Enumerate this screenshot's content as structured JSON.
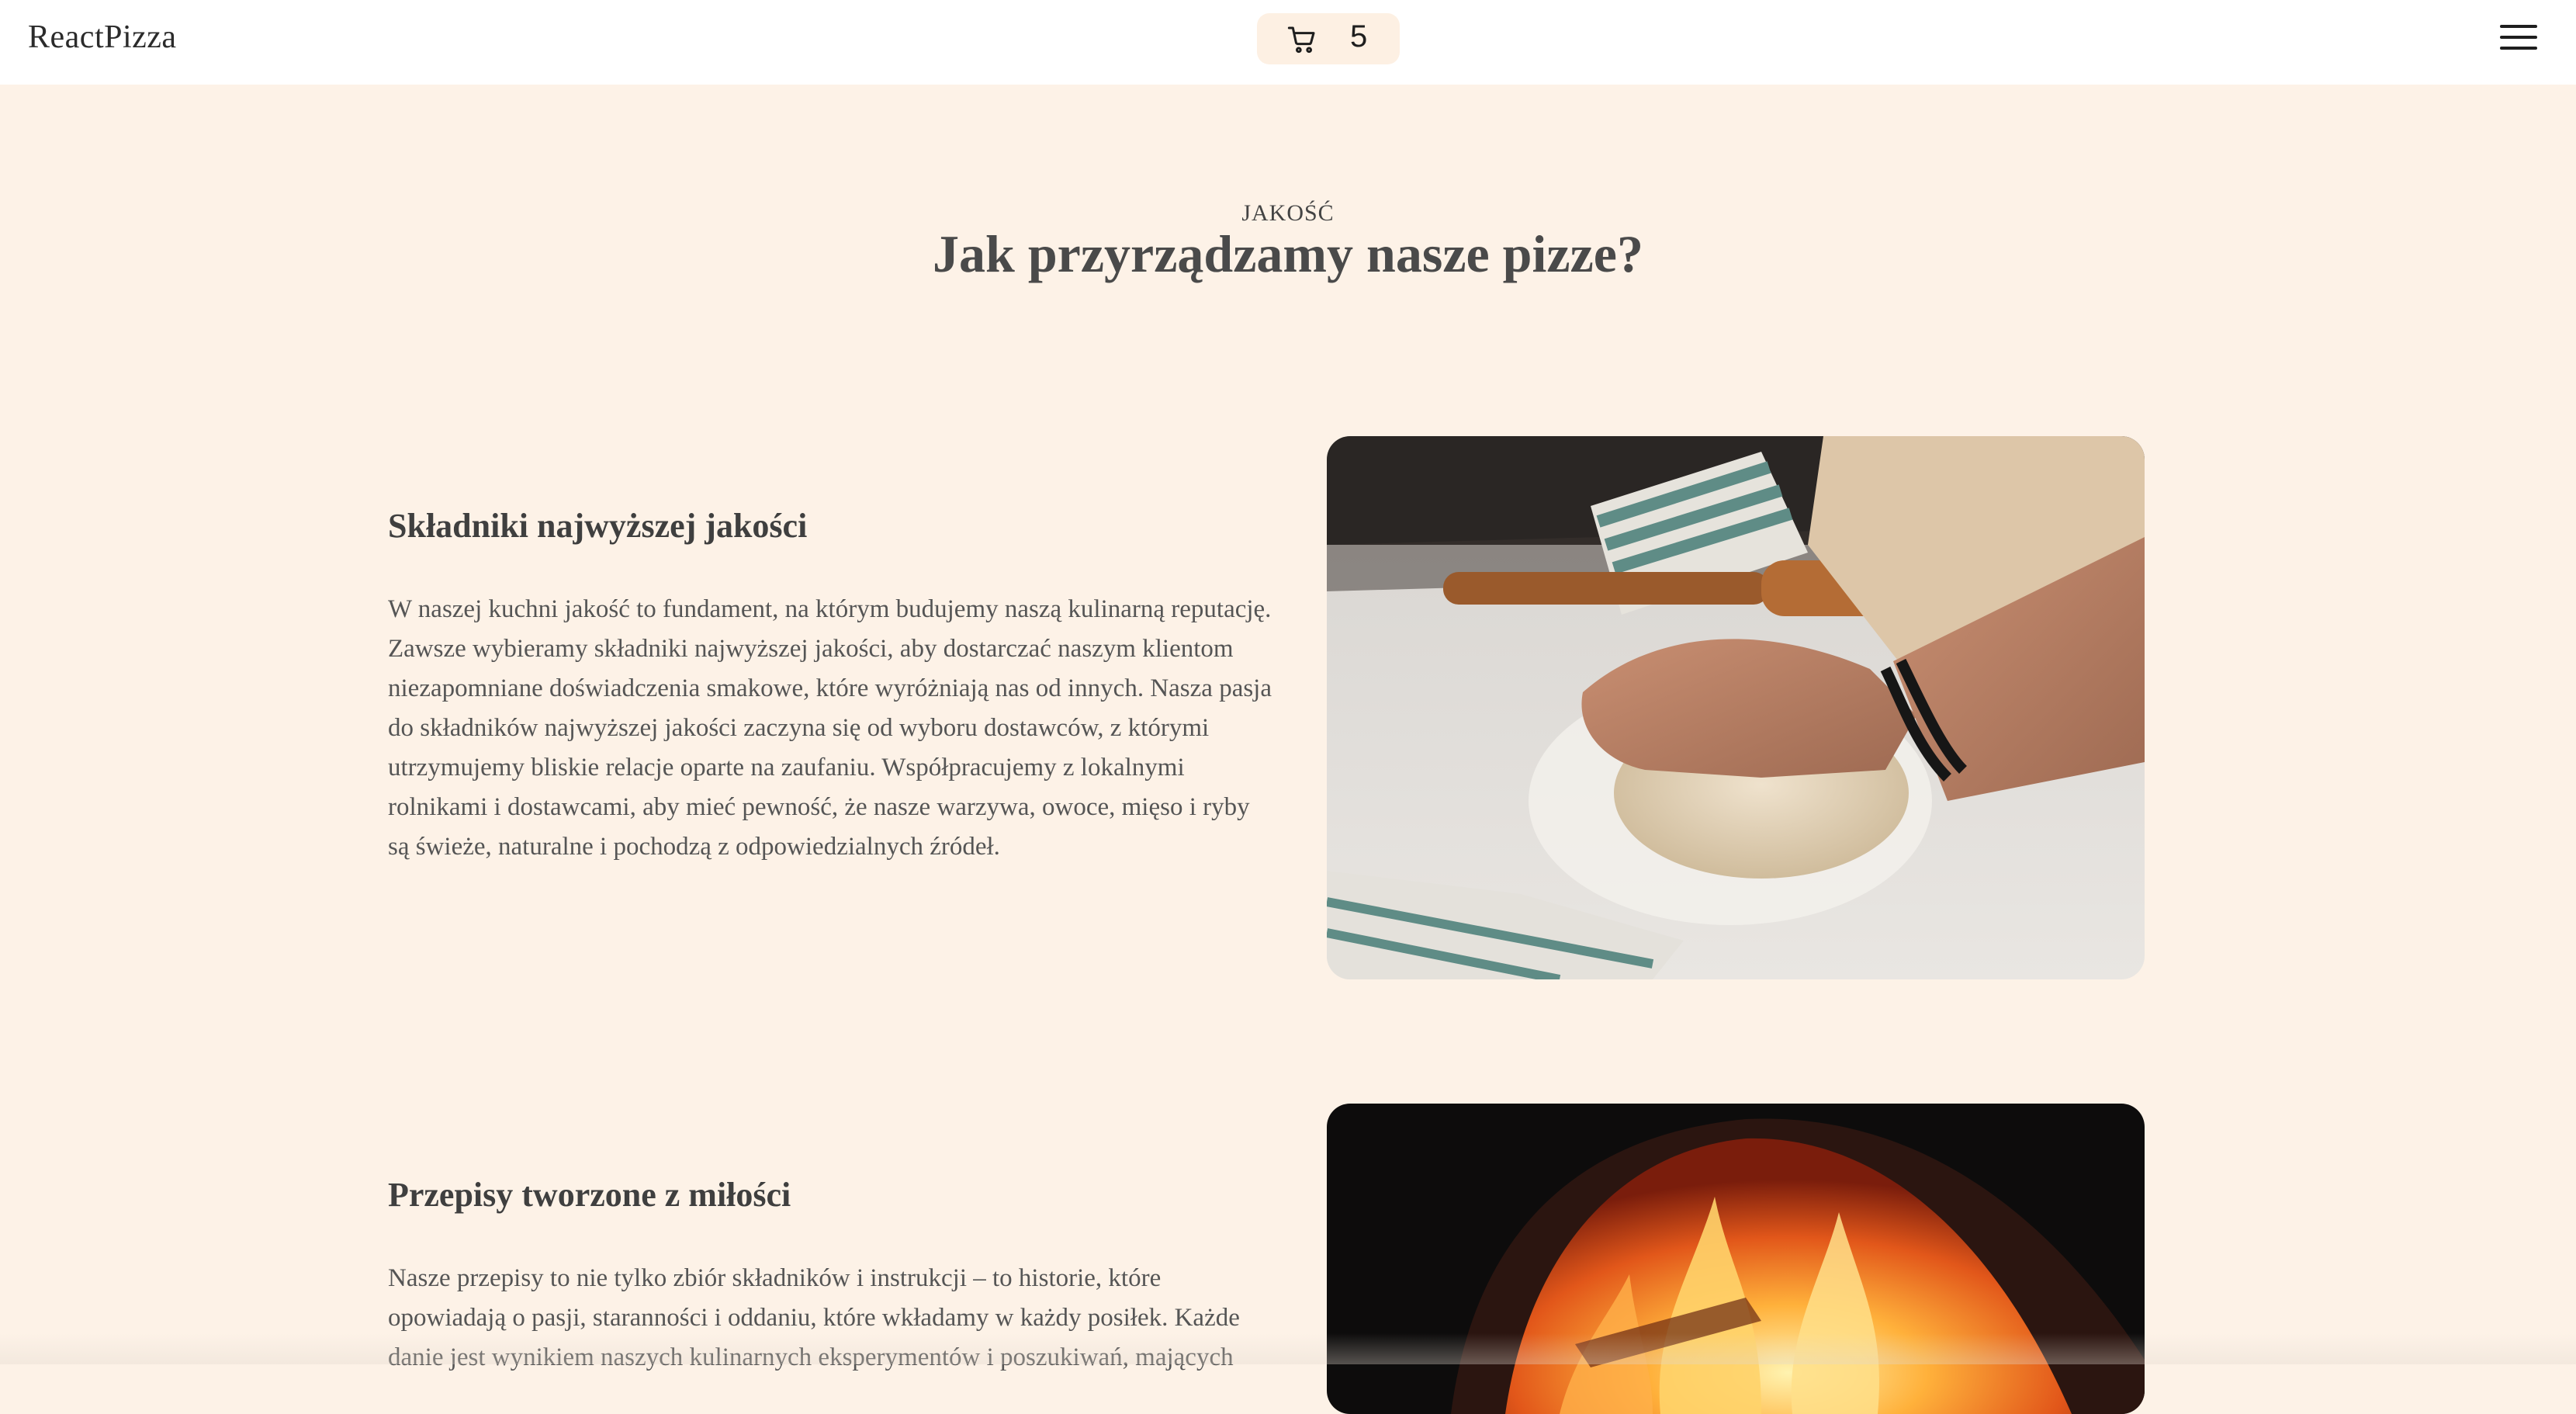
{
  "header": {
    "logo": "ReactPizza",
    "cart_count": "5",
    "cart_icon": "cart-icon",
    "menu_icon": "hamburger-menu-icon"
  },
  "section": {
    "label": "JAKOŚĆ",
    "title": "Jak przyrządzamy nasze pizze?"
  },
  "features": [
    {
      "title": "Składniki najwyższej jakości",
      "text": "W naszej kuchni jakość to fundament, na którym budujemy naszą kulinarną reputację. Zawsze wybieramy składniki najwyższej jakości, aby dostarczać naszym klientom niezapomniane doświadczenia smakowe, które wyróżniają nas od innych. Nasza pasja do składników najwyższej jakości zaczyna się od wyboru dostawców, z którymi utrzymujemy bliskie relacje oparte na zaufaniu. Współpracujemy z lokalnymi rolnikami i dostawcami, aby mieć pewność, że nasze warzywa, owoce, mięso i ryby są świeże, naturalne i pochodzą z odpowiedzialnych źródeł."
    },
    {
      "title": "Przepisy tworzone z miłości",
      "text": "Nasze przepisy to nie tylko zbiór składników i instrukcji – to historie, które opowiadają o pasji, staranności i oddaniu, które wkładamy w każdy posiłek. Każde danie jest wynikiem naszych kulinarnych eksperymentów i poszukiwań, mających"
    }
  ],
  "colors": {
    "background": "#fdf2e7",
    "header": "#ffffff",
    "cart_badge": "#fdf0e3"
  }
}
